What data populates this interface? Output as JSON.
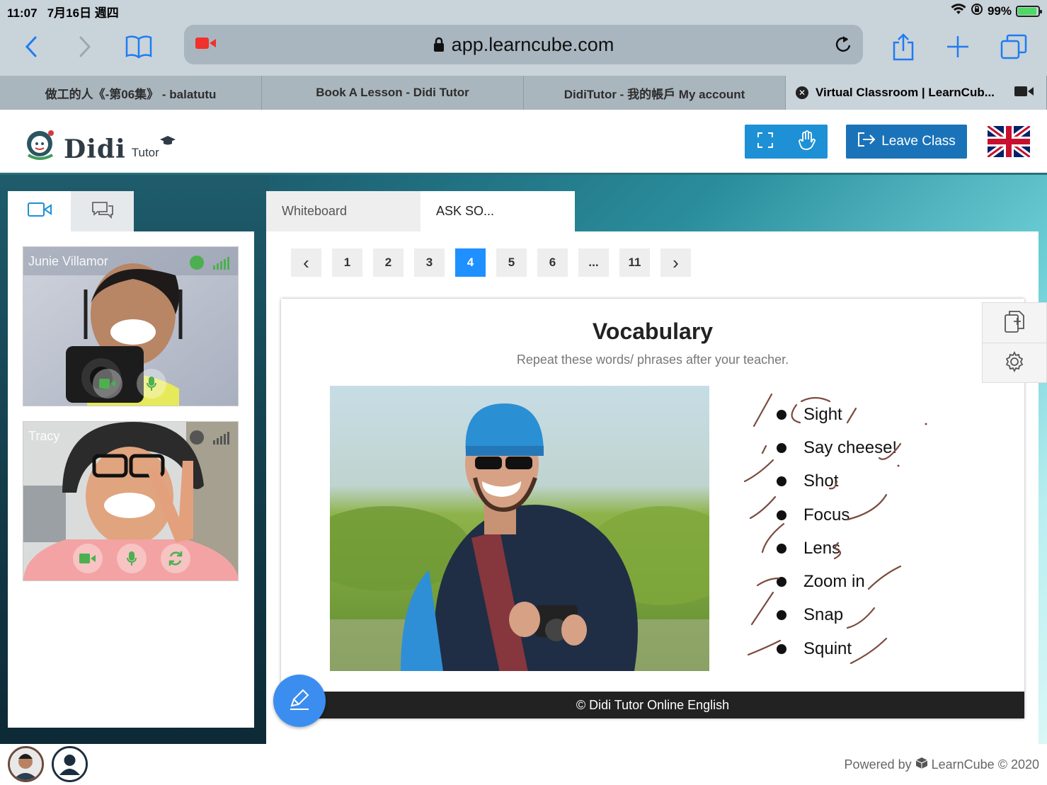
{
  "status_bar": {
    "time": "11:07",
    "date": "7月16日 週四",
    "battery": "99%"
  },
  "browser": {
    "url": "app.learncube.com",
    "tabs": [
      {
        "label": "做工的人《-第06集》 - balatutu",
        "active": false
      },
      {
        "label": "Book A Lesson - Didi Tutor",
        "active": false
      },
      {
        "label": "DidiTutor - 我的帳戶 My account",
        "active": false
      },
      {
        "label": "Virtual Classroom | LearnCub...",
        "active": true
      }
    ]
  },
  "header": {
    "logo_main": "Didi",
    "logo_sub": "Tutor",
    "leave_button": "Leave Class"
  },
  "participants": [
    {
      "name": "Junie Villamor",
      "status_color": "#4caf50"
    },
    {
      "name": "Tracy",
      "status_color": "#555555"
    }
  ],
  "main_tabs": [
    "Whiteboard",
    "ASK SO..."
  ],
  "pager": {
    "prev": "‹",
    "pages": [
      "1",
      "2",
      "3",
      "4",
      "5",
      "6",
      "...",
      "11"
    ],
    "current": "4",
    "next": "›"
  },
  "slide": {
    "title": "Vocabulary",
    "subtitle": "Repeat these words/ phrases after your teacher.",
    "words": [
      "Sight",
      "Say cheese!",
      "Shot",
      "Focus",
      "Lens",
      "Zoom in",
      "Snap",
      "Squint"
    ],
    "footer": "© Didi Tutor Online English"
  },
  "footer": {
    "powered_by": "Powered by",
    "brand": "LearnCube",
    "copyright": "© 2020"
  },
  "colors": {
    "accent": "#1e90d6",
    "leave": "#1a73b8",
    "page_active": "#1e90ff",
    "annotation": "#7a4b3e"
  }
}
